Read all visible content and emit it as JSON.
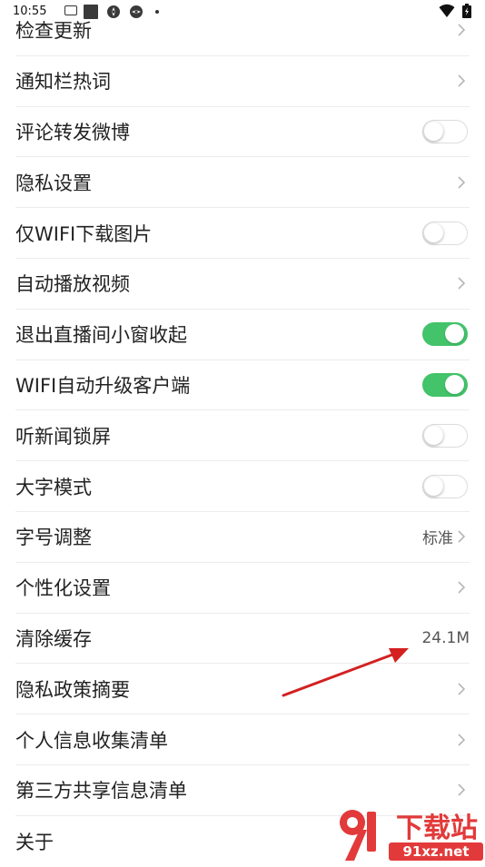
{
  "status_bar": {
    "time": "10:55",
    "icons": [
      "news-icon",
      "square-icon",
      "aperture-icon",
      "aperture-icon",
      "dot-icon",
      "wifi-icon",
      "battery-charging-icon"
    ]
  },
  "settings": [
    {
      "label": "检查更新",
      "control": "chevron"
    },
    {
      "label": "通知栏热词",
      "control": "chevron"
    },
    {
      "label": "评论转发微博",
      "control": "toggle",
      "on": false
    },
    {
      "label": "隐私设置",
      "control": "chevron"
    },
    {
      "label": "仅WIFI下载图片",
      "control": "toggle",
      "on": false
    },
    {
      "label": "自动播放视频",
      "control": "chevron"
    },
    {
      "label": "退出直播间小窗收起",
      "control": "toggle",
      "on": true
    },
    {
      "label": "WIFI自动升级客户端",
      "control": "toggle",
      "on": true
    },
    {
      "label": "听新闻锁屏",
      "control": "toggle",
      "on": false
    },
    {
      "label": "大字模式",
      "control": "toggle",
      "on": false
    },
    {
      "label": "字号调整",
      "control": "value-chevron",
      "value": "标准"
    },
    {
      "label": "个性化设置",
      "control": "chevron"
    },
    {
      "label": "清除缓存",
      "control": "value",
      "value": "24.1M"
    },
    {
      "label": "隐私政策摘要",
      "control": "chevron"
    },
    {
      "label": "个人信息收集清单",
      "control": "chevron"
    },
    {
      "label": "第三方共享信息清单",
      "control": "chevron"
    },
    {
      "label": "关于",
      "control": "none"
    }
  ],
  "colors": {
    "toggle_on": "#43c36a",
    "annotation_arrow": "#d42020",
    "watermark": "#e23a3a"
  },
  "watermark": {
    "logo_text": "下载站",
    "url_text": "91xz.net"
  }
}
